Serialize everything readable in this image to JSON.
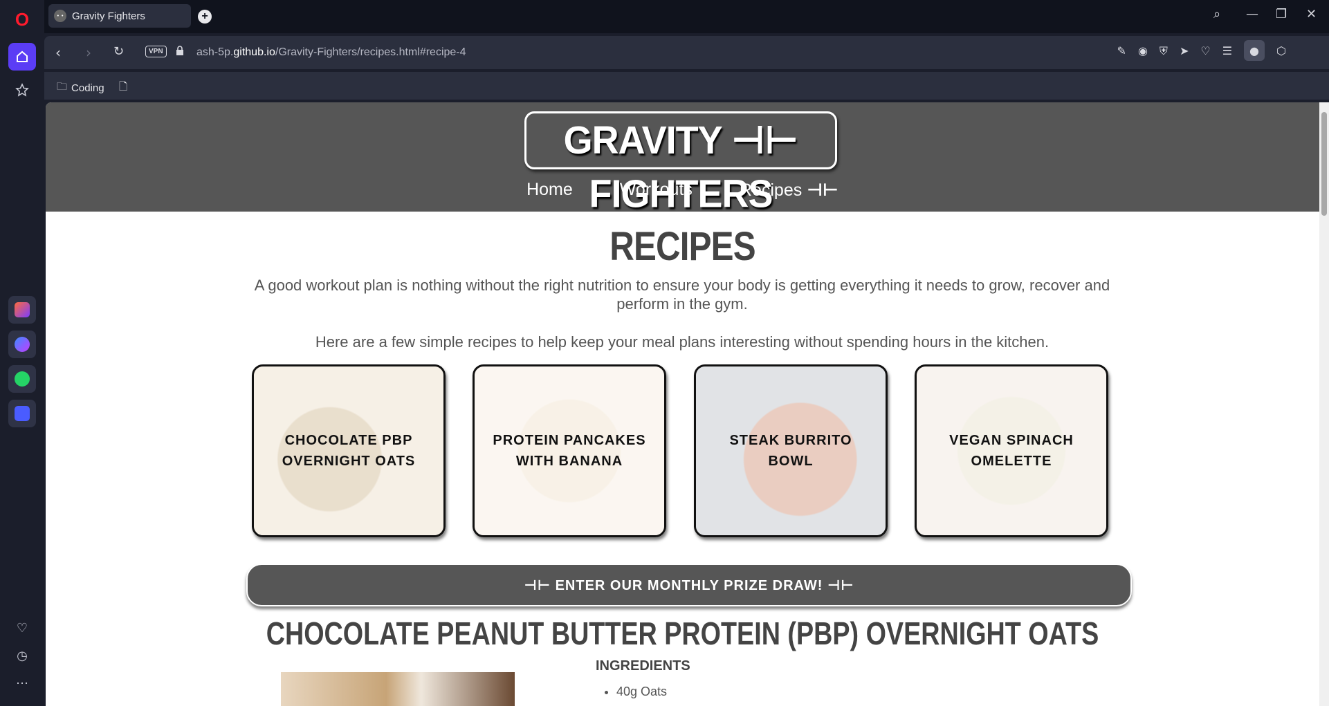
{
  "browser": {
    "tab_title": "Gravity Fighters",
    "tab_favicon_text": "• •",
    "new_tab_symbol": "+",
    "url_prefix": "ash-5p.",
    "url_domain": "github.io",
    "url_path": "/Gravity-Fighters/recipes.html#recipe-4",
    "vpn_label": "VPN",
    "bookmark_folder": "Coding",
    "accent_color": "#5b3df5"
  },
  "site": {
    "logo_text": "GRAVITY ⭐ FIGHTERS",
    "logo_left": "GRAVITY",
    "logo_right": "FIGHTERS",
    "nav": {
      "home": "Home",
      "workouts": "Workouts",
      "recipes": "Recipes"
    }
  },
  "recipes": {
    "title": "RECIPES",
    "intro": "A good workout plan is nothing without the right nutrition to ensure your body is getting everything it needs to grow, recover and perform in the gym.",
    "intro2": "Here are a few simple recipes to help keep your meal plans interesting without spending hours in the kitchen.",
    "cards": [
      {
        "label": "CHOCOLATE PBP OVERNIGHT OATS"
      },
      {
        "label": "PROTEIN PANCAKES WITH BANANA"
      },
      {
        "label": "STEAK BURRITO BOWL"
      },
      {
        "label": "VEGAN SPINACH OMELETTE"
      }
    ],
    "prize_text": "ENTER OUR MONTHLY PRIZE DRAW!",
    "section_title": "CHOCOLATE PEANUT BUTTER PROTEIN (PBP) OVERNIGHT OATS",
    "ingredients_title": "INGREDIENTS",
    "ingredients": [
      "40g Oats"
    ]
  }
}
